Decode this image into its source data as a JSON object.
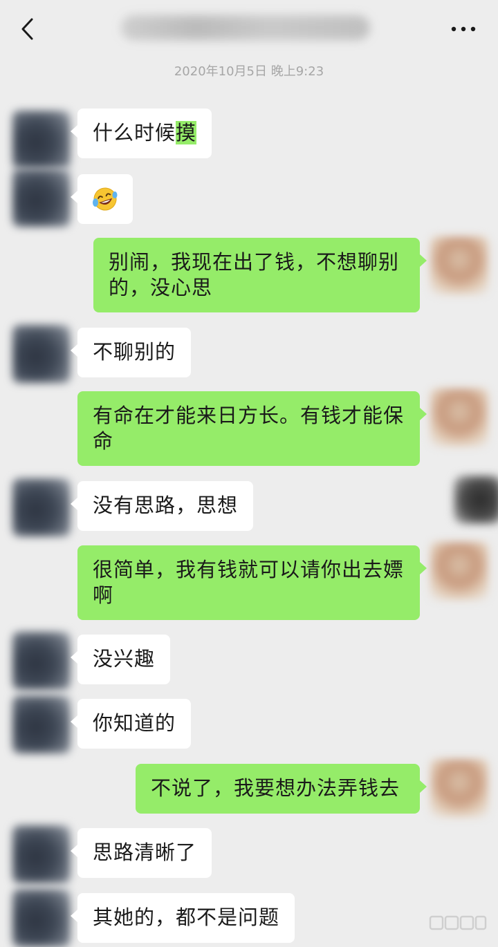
{
  "header": {
    "title": "",
    "back_icon": "chevron-left-icon",
    "more_icon": "ellipsis-icon"
  },
  "timestamp": "2020年10月5日 晚上9:23",
  "colors": {
    "background": "#ededed",
    "bubble_incoming": "#ffffff",
    "bubble_outgoing": "#95ec69",
    "timestamp": "#a6a6a6"
  },
  "messages": [
    {
      "side": "in",
      "text_before": "什么时候",
      "text_highlight": "摸"
    },
    {
      "side": "in",
      "emoji": "laughing-crying-emoji"
    },
    {
      "side": "out",
      "line1": "别闹，我现在出了钱，不想聊别",
      "line2": "的，没心思"
    },
    {
      "side": "in",
      "text": "不聊别的"
    },
    {
      "side": "out",
      "line1": "有命在才能来日方长。有钱才能保",
      "line2": "命"
    },
    {
      "side": "in",
      "text": "没有思路，思想"
    },
    {
      "side": "out",
      "line1": "很简单，我有钱就可以请你出去嫖",
      "line2": "啊"
    },
    {
      "side": "in",
      "text": "没兴趣"
    },
    {
      "side": "in",
      "text": "你知道的"
    },
    {
      "side": "out",
      "text": "不说了，我要想办法弄钱去"
    },
    {
      "side": "in",
      "text": "思路清晰了"
    },
    {
      "side": "in",
      "text": "其她的，都不是问题"
    }
  ]
}
